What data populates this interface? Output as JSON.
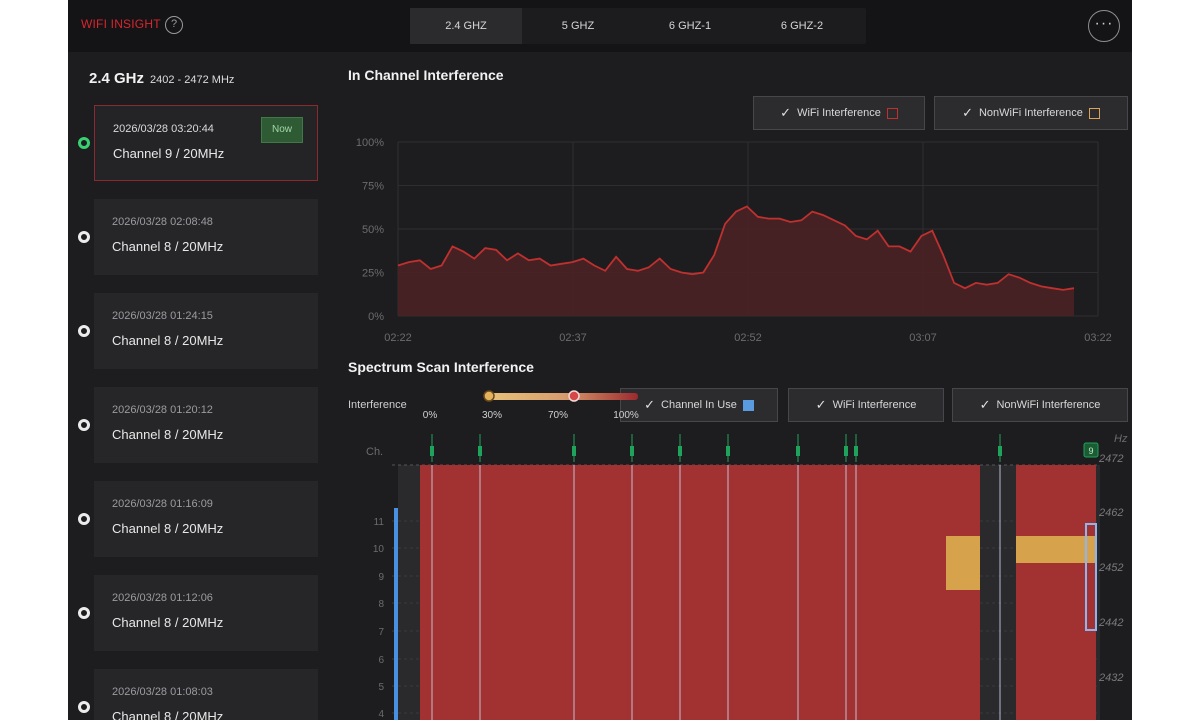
{
  "app": {
    "title": "WIFI INSIGHT",
    "help_glyph": "?",
    "more_glyph": "···"
  },
  "band_tabs": [
    {
      "label": "2.4 GHZ",
      "active": true
    },
    {
      "label": "5 GHZ",
      "active": false
    },
    {
      "label": "6 GHZ-1",
      "active": false
    },
    {
      "label": "6 GHZ-2",
      "active": false
    }
  ],
  "left_panel": {
    "band": "2.4 GHz",
    "range": "2402 - 2472 MHz",
    "now_label": "Now",
    "scans": [
      {
        "timestamp": "2026/03/28 03:20:44",
        "channel": "Channel 9 / 20MHz",
        "current": true
      },
      {
        "timestamp": "2026/03/28 02:08:48",
        "channel": "Channel 8 / 20MHz",
        "current": false
      },
      {
        "timestamp": "2026/03/28 01:24:15",
        "channel": "Channel 8 / 20MHz",
        "current": false
      },
      {
        "timestamp": "2026/03/28 01:20:12",
        "channel": "Channel 8 / 20MHz",
        "current": false
      },
      {
        "timestamp": "2026/03/28 01:16:09",
        "channel": "Channel 8 / 20MHz",
        "current": false
      },
      {
        "timestamp": "2026/03/28 01:12:06",
        "channel": "Channel 8 / 20MHz",
        "current": false
      },
      {
        "timestamp": "2026/03/28 01:08:03",
        "channel": "Channel 8 / 20MHz",
        "current": false
      }
    ]
  },
  "in_channel": {
    "title": "In Channel Interference",
    "toggles": [
      {
        "label": "WiFi Interference",
        "color": "#c0302f"
      },
      {
        "label": "NonWiFi Interference",
        "color": "#d8a25a"
      }
    ]
  },
  "spectrum": {
    "title": "Spectrum Scan Interference",
    "legend_label": "Interference",
    "legend_ticks": [
      "0%",
      "30%",
      "70%",
      "100%"
    ],
    "toggles": [
      {
        "label": "Channel In Use",
        "color": "#5a9be0"
      },
      {
        "label": "WiFi Interference",
        "color": ""
      },
      {
        "label": "NonWiFi Interference",
        "color": ""
      }
    ],
    "ch_label": "Ch.",
    "hz_label": "Hz",
    "channel_ticks": [
      "11",
      "10",
      "9",
      "8",
      "7",
      "6",
      "5",
      "4"
    ],
    "freq_ticks": [
      "2472",
      "2462",
      "2452",
      "2442",
      "2432"
    ],
    "selected_badge": "9",
    "colors": {
      "wifi": "#a23232",
      "nonwifi": "#d6a24c",
      "channel_in_use": "#4a90e2",
      "marker": "#1fa35a"
    }
  },
  "chart_data": {
    "type": "area",
    "x_ticks": [
      "02:22",
      "02:37",
      "02:52",
      "03:07",
      "03:22"
    ],
    "y_ticks": [
      "100%",
      "75%",
      "50%",
      "25%",
      "0%"
    ],
    "ylim": [
      0,
      100
    ],
    "grid": true,
    "series": [
      {
        "color": "#c0302f",
        "values": [
          29,
          31,
          32,
          27,
          29,
          40,
          37,
          33,
          39,
          38,
          32,
          36,
          32,
          33,
          29,
          30,
          31,
          33,
          29,
          26,
          34,
          27,
          26,
          28,
          33,
          27,
          25,
          24,
          25,
          35,
          53,
          60,
          63,
          57,
          56,
          56,
          54,
          55,
          60,
          58,
          55,
          52,
          46,
          44,
          49,
          40,
          40,
          37,
          46,
          49,
          35,
          19,
          16,
          19,
          18,
          19,
          24,
          22,
          19,
          17,
          16,
          15,
          16
        ]
      }
    ]
  }
}
